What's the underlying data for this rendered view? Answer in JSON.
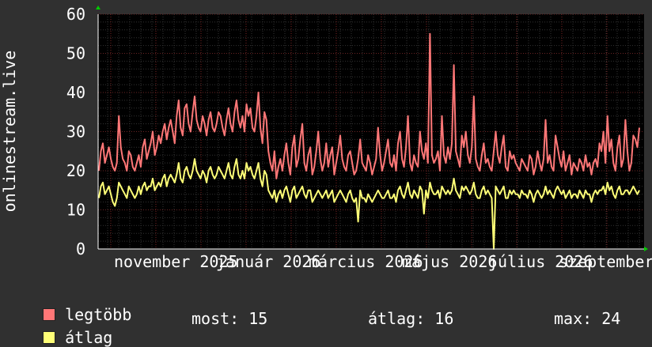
{
  "chart_data": {
    "type": "line",
    "ylabel": "onlinestream.live",
    "ylim": [
      0,
      60
    ],
    "yticks": [
      0,
      10,
      20,
      30,
      40,
      50,
      60
    ],
    "xlabels": [
      "november 2025",
      "január 2026",
      "március 2026",
      "május 2026",
      "július 2026",
      "szeptember"
    ],
    "series": [
      {
        "name": "legtöbb",
        "color": "#ff7777",
        "values": [
          20,
          25,
          27,
          22,
          24,
          26,
          23,
          21,
          20,
          22,
          34,
          26,
          23,
          22,
          20,
          25,
          24,
          21,
          20,
          22,
          24,
          21,
          26,
          28,
          23,
          25,
          27,
          30,
          24,
          26,
          29,
          27,
          30,
          32,
          28,
          31,
          33,
          30,
          27,
          34,
          38,
          31,
          29,
          36,
          37,
          32,
          30,
          35,
          39,
          33,
          31,
          30,
          34,
          32,
          29,
          33,
          35,
          31,
          30,
          32,
          35,
          34,
          31,
          29,
          33,
          36,
          32,
          30,
          35,
          38,
          33,
          31,
          34,
          30,
          37,
          34,
          36,
          31,
          30,
          34,
          40,
          31,
          27,
          35,
          33,
          25,
          22,
          20,
          25,
          18,
          21,
          23,
          20,
          24,
          27,
          22,
          19,
          26,
          29,
          21,
          23,
          28,
          32,
          22,
          20,
          24,
          26,
          19,
          21,
          25,
          30,
          23,
          20,
          22,
          27,
          21,
          24,
          26,
          19,
          22,
          25,
          29,
          23,
          21,
          20,
          24,
          25,
          22,
          19,
          20,
          23,
          28,
          22,
          21,
          20,
          24,
          22,
          19,
          21,
          23,
          31,
          24,
          20,
          22,
          25,
          28,
          22,
          21,
          24,
          20,
          27,
          30,
          23,
          21,
          26,
          34,
          22,
          20,
          24,
          22,
          21,
          30,
          25,
          23,
          27,
          22,
          55,
          24,
          22,
          23,
          25,
          20,
          34,
          24,
          22,
          26,
          23,
          27,
          47,
          25,
          23,
          21,
          29,
          26,
          30,
          24,
          22,
          26,
          39,
          23,
          21,
          20,
          24,
          27,
          22,
          23,
          21,
          20,
          25,
          30,
          24,
          22,
          26,
          29,
          21,
          20,
          25,
          23,
          24,
          22,
          21,
          20,
          23,
          22,
          21,
          20,
          24,
          23,
          19,
          21,
          25,
          22,
          20,
          23,
          33,
          22,
          24,
          21,
          20,
          29,
          26,
          23,
          21,
          25,
          20,
          22,
          24,
          19,
          22,
          21,
          20,
          23,
          22,
          20,
          24,
          21,
          22,
          19,
          22,
          23,
          21,
          27,
          25,
          30,
          22,
          34,
          25,
          28,
          22,
          20,
          26,
          29,
          21,
          23,
          33,
          25,
          20,
          22,
          29,
          28,
          26,
          31
        ]
      },
      {
        "name": "átlag",
        "color": "#ffff77",
        "values": [
          13,
          16,
          17,
          14,
          15,
          16,
          14,
          12,
          11,
          13,
          17,
          16,
          15,
          14,
          13,
          16,
          15,
          14,
          13,
          14,
          16,
          14,
          16,
          17,
          15,
          16,
          16,
          18,
          15,
          16,
          17,
          16,
          18,
          19,
          16,
          18,
          19,
          18,
          17,
          19,
          22,
          18,
          17,
          20,
          21,
          19,
          18,
          20,
          23,
          20,
          19,
          18,
          20,
          19,
          17,
          20,
          21,
          19,
          18,
          19,
          21,
          20,
          19,
          18,
          20,
          22,
          19,
          18,
          21,
          23,
          19,
          18,
          20,
          18,
          22,
          20,
          21,
          19,
          18,
          20,
          22,
          18,
          16,
          20,
          19,
          15,
          14,
          13,
          15,
          12,
          14,
          15,
          13,
          15,
          16,
          14,
          12,
          15,
          16,
          13,
          14,
          15,
          16,
          14,
          13,
          15,
          15,
          12,
          13,
          14,
          15,
          14,
          13,
          14,
          15,
          13,
          14,
          15,
          12,
          13,
          14,
          15,
          14,
          13,
          12,
          14,
          15,
          13,
          12,
          13,
          14,
          15,
          13,
          13,
          12,
          14,
          13,
          12,
          13,
          14,
          15,
          14,
          13,
          13,
          14,
          15,
          13,
          13,
          14,
          12,
          15,
          16,
          14,
          13,
          15,
          17,
          14,
          13,
          15,
          14,
          13,
          16,
          15,
          14,
          15,
          13,
          17,
          15,
          14,
          14,
          15,
          13,
          16,
          15,
          14,
          15,
          14,
          15,
          18,
          15,
          14,
          13,
          16,
          15,
          16,
          15,
          14,
          15,
          17,
          14,
          13,
          13,
          15,
          16,
          14,
          15,
          14,
          13,
          15,
          16,
          15,
          14,
          15,
          16,
          13,
          13,
          15,
          14,
          15,
          14,
          14,
          13,
          15,
          14,
          14,
          13,
          15,
          14,
          12,
          14,
          15,
          14,
          13,
          14,
          16,
          14,
          15,
          14,
          13,
          15,
          16,
          15,
          14,
          15,
          13,
          14,
          15,
          13,
          14,
          14,
          13,
          15,
          14,
          13,
          15,
          14,
          14,
          12,
          14,
          15,
          14,
          15,
          15,
          16,
          14,
          17,
          15,
          16,
          14,
          13,
          15,
          16,
          14,
          14,
          15,
          15,
          14,
          15,
          16,
          15,
          14,
          15
        ]
      }
    ],
    "dips": [
      [
        130,
        7
      ],
      [
        163,
        9
      ],
      [
        198,
        0
      ]
    ]
  },
  "legend": [
    {
      "name": "legtöbb",
      "color": "#ff7777"
    },
    {
      "name": "átlag",
      "color": "#ffff77"
    }
  ],
  "stats": {
    "most": "most: 15",
    "atlag": "átlag: 16",
    "max": "max: 24"
  }
}
